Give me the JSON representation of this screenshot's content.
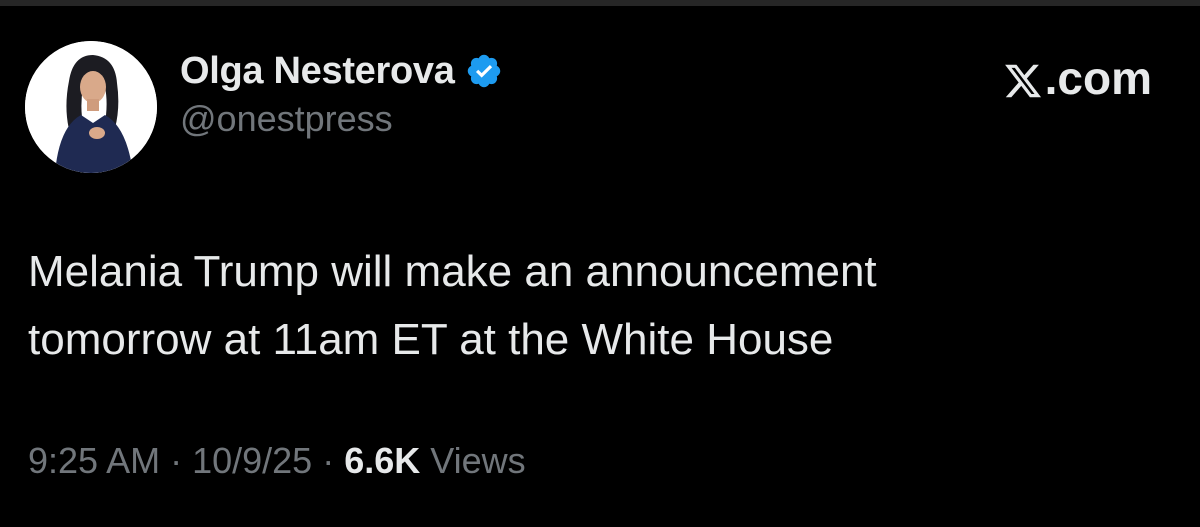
{
  "author": {
    "display_name": "Olga Nesterova",
    "handle": "@onestpress",
    "verified": true,
    "avatar_icon": "profile-photo"
  },
  "brand": {
    "label": ".com",
    "logo_icon": "x-logo-icon"
  },
  "tweet": {
    "lines": [
      "Melania Trump will make an announcement",
      "tomorrow at 11am ET at the White House"
    ]
  },
  "meta": {
    "time": "9:25 AM",
    "separator": " · ",
    "date": "10/9/25",
    "views_count": "6.6K",
    "views_label": " Views"
  },
  "colors": {
    "background": "#000000",
    "primary_text": "#e7e9ea",
    "secondary_text": "#71767b",
    "verified_blue": "#1d9bf0"
  }
}
